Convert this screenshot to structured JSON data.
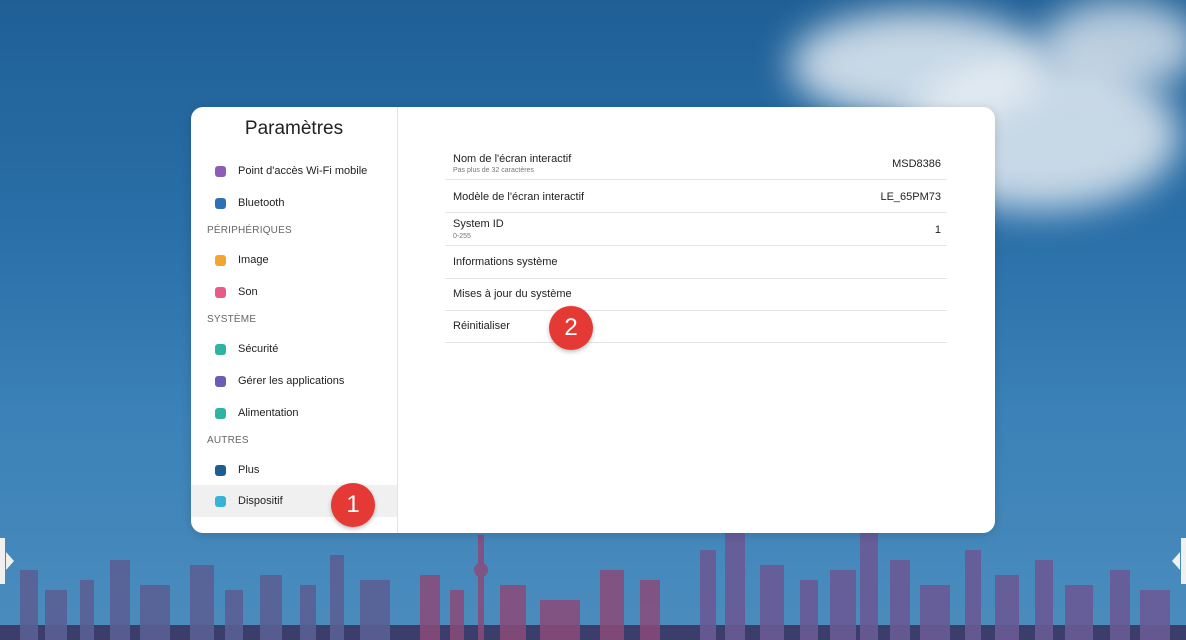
{
  "settings": {
    "title": "Paramètres",
    "sidebar": {
      "items": [
        {
          "label": "Point d'accès Wi-Fi mobile",
          "icon": "wifi-hotspot-icon",
          "color": "#8e5bb5"
        },
        {
          "label": "Bluetooth",
          "icon": "bluetooth-icon",
          "color": "#2e6fb5"
        },
        {
          "label": "Image",
          "icon": "image-icon",
          "color": "#f2a531"
        },
        {
          "label": "Son",
          "icon": "sound-icon",
          "color": "#e85b86"
        },
        {
          "label": "Sécurité",
          "icon": "security-icon",
          "color": "#2fb3a3"
        },
        {
          "label": "Gérer les applications",
          "icon": "apps-icon",
          "color": "#6a5bb5"
        },
        {
          "label": "Alimentation",
          "icon": "power-icon",
          "color": "#2fb3a3"
        },
        {
          "label": "Plus",
          "icon": "more-icon",
          "color": "#1f5c8f"
        },
        {
          "label": "Dispositif",
          "icon": "device-icon",
          "color": "#37b3d6",
          "active": true
        }
      ],
      "sections": {
        "peripherals": "PÉRIPHÉRIQUES",
        "system": "SYSTÈME",
        "others": "AUTRES"
      }
    },
    "content": {
      "rows": [
        {
          "label": "Nom de l'écran interactif",
          "sub": "Pas plus de 32 caractères",
          "value": "MSD8386"
        },
        {
          "label": "Modèle de l'écran interactif",
          "sub": "",
          "value": "LE_65PM73"
        },
        {
          "label": "System ID",
          "sub": "0-255",
          "value": "1"
        },
        {
          "label": "Informations système",
          "sub": "",
          "value": ""
        },
        {
          "label": "Mises à jour du système",
          "sub": "",
          "value": ""
        },
        {
          "label": "Réinitialiser",
          "sub": "",
          "value": ""
        }
      ]
    }
  },
  "annotations": {
    "step1": "1",
    "step2": "2",
    "color": "#e53935"
  }
}
